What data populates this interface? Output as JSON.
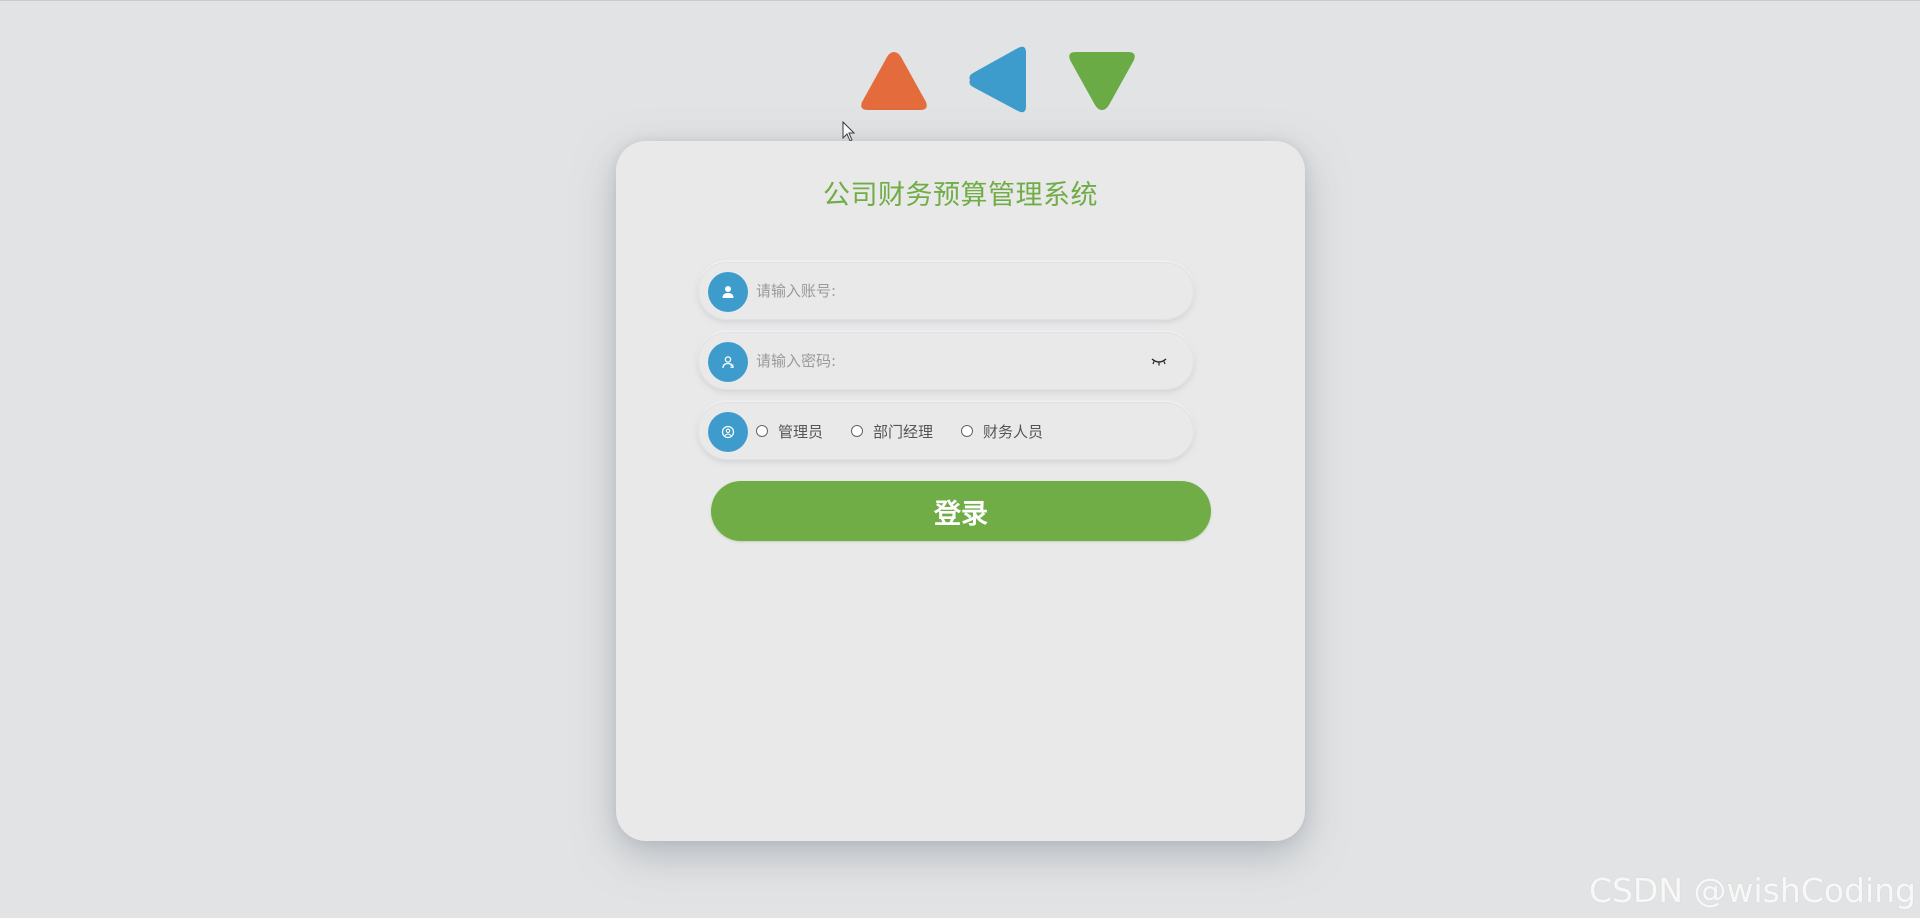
{
  "decor": {
    "shapes": [
      {
        "name": "triangle-up",
        "color": "#e46c3c"
      },
      {
        "name": "triangle-left",
        "color": "#3d9ccc"
      },
      {
        "name": "triangle-down",
        "color": "#6aab45"
      }
    ]
  },
  "login": {
    "title": "公司财务预算管理系统",
    "account": {
      "icon": "user-icon",
      "placeholder": "请输入账号:",
      "value": ""
    },
    "password": {
      "icon": "user-card-icon",
      "placeholder": "请输入密码:",
      "value": "",
      "toggle_icon": "eye-closed-icon"
    },
    "role": {
      "icon": "role-icon",
      "options": [
        "管理员",
        "部门经理",
        "财务人员"
      ],
      "selected": null
    },
    "submit_label": "登录"
  },
  "watermark": "CSDN @wishCoding",
  "colors": {
    "accent_green": "#70ad47",
    "icon_blue": "#3d9ccc",
    "background": "#e2e3e4",
    "card": "#e9e9ea"
  }
}
